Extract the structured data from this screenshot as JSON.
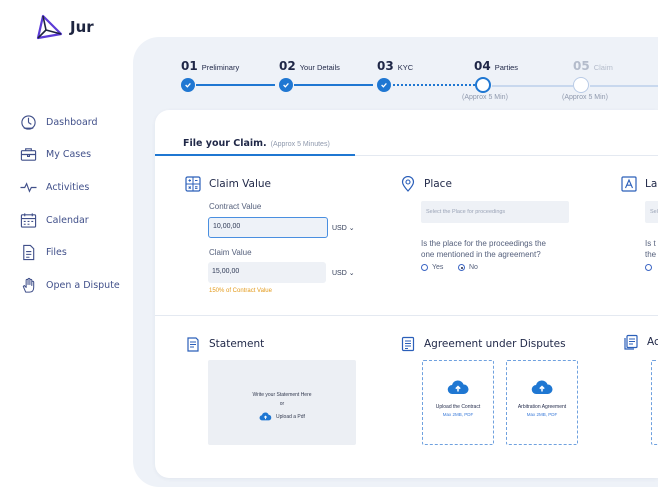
{
  "app": {
    "name": "Jur"
  },
  "sidebar": {
    "items": [
      {
        "label": "Dashboard",
        "icon": "dashboard-icon"
      },
      {
        "label": "My Cases",
        "icon": "briefcase-icon"
      },
      {
        "label": "Activities",
        "icon": "activity-pulse-icon"
      },
      {
        "label": "Calendar",
        "icon": "calendar-icon"
      },
      {
        "label": "Files",
        "icon": "file-icon"
      },
      {
        "label": "Open a Dispute",
        "icon": "hand-icon"
      }
    ]
  },
  "steps": [
    {
      "num": "01",
      "name": "Preliminary",
      "state": "done"
    },
    {
      "num": "02",
      "name": "Your Details",
      "state": "done"
    },
    {
      "num": "03",
      "name": "KYC",
      "state": "done"
    },
    {
      "num": "04",
      "name": "Parties",
      "state": "current",
      "sub": "(Approx 5 Min)"
    },
    {
      "num": "05",
      "name": "Claim",
      "state": "future",
      "sub": "(Approx 5 Min)"
    }
  ],
  "form": {
    "tab_title": "File your Claim.",
    "tab_time": "(Approx 5 Minutes)",
    "claim_value": {
      "title": "Claim Value",
      "contract_label": "Contract Value",
      "contract_value": "10,00,00",
      "contract_currency": "USD",
      "claim_label": "Claim Value",
      "claim_value": "15,00,00",
      "claim_currency": "USD",
      "hint": "150% of Contract Value"
    },
    "place": {
      "title": "Place",
      "placeholder": "Select the Place for proceedings",
      "question_line1": "Is the place for the proceedings the",
      "question_line2": "one mentioned in the agreement?",
      "yes": "Yes",
      "no": "No",
      "selected": "No"
    },
    "language": {
      "title_partial": "La",
      "placeholder_partial": "Sel",
      "question_partial_1": "Is t",
      "question_partial_2": "the"
    },
    "statement": {
      "title": "Statement",
      "line1": "Write your Statement Here",
      "or": "or",
      "upload": "Upload a Pdf"
    },
    "agreement": {
      "title": "Agreement under Disputes",
      "drops": [
        {
          "label": "Upload the Contract",
          "sub": "Max 2MB, PDF"
        },
        {
          "label": "Arbitration Agreement",
          "sub": "Max 2MB, PDF"
        }
      ]
    },
    "fourth_partial": {
      "title_partial": "Ac"
    }
  },
  "colors": {
    "accent": "#1f77d2",
    "panel_bg": "#eef2f8",
    "hint": "#e39a1a",
    "logo_purple": "#5b3bd6"
  }
}
